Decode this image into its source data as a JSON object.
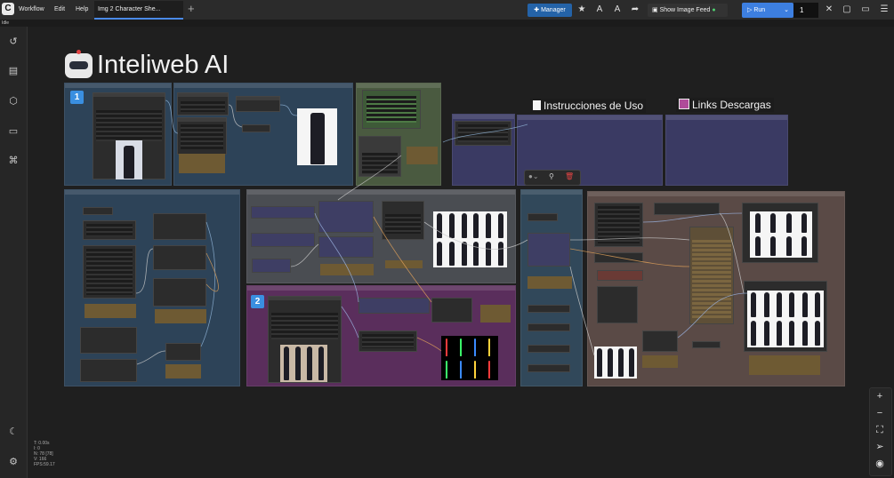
{
  "app": {
    "logo": "C",
    "status": "Idle"
  },
  "menu": [
    "Workflow",
    "Edit",
    "Help"
  ],
  "tabs": [
    {
      "label": "Img 2 Character She...",
      "active": true
    }
  ],
  "toolbar": {
    "manager_label": "Manager",
    "show_feed_label": "Show Image Feed",
    "run_label": "Run",
    "run_count": "1"
  },
  "canvas": {
    "title": "Inteliweb AI",
    "notes": [
      {
        "label": "Instrucciones de Uso",
        "icon": "document-icon"
      },
      {
        "label": "Links Descargas",
        "icon": "floppy-disk-icon"
      }
    ],
    "badges": [
      "1",
      "2"
    ]
  },
  "stats": [
    "T: 0.00s",
    "I: 0",
    "N: 78 [78]",
    "V: 166",
    "FPS:59.17"
  ],
  "colors": {
    "accent": "#3d7fe0",
    "manager": "#2463a8",
    "group_blue": "#2d4358",
    "group_green": "#4a5a40",
    "group_violet": "#3a3a63",
    "group_gray": "#4a4d52",
    "group_purple": "#5a2e5c",
    "group_teal": "#31485a",
    "group_brown": "#5a4a46"
  }
}
